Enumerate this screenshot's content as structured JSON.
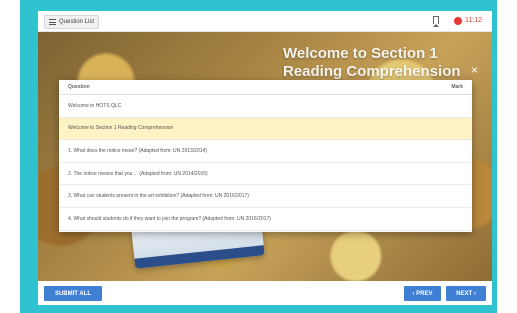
{
  "topbar": {
    "question_list_label": "Question List",
    "timer": "11:12",
    "icons": [
      "menu-icon",
      "bookmark-icon",
      "timer-dot-icon"
    ]
  },
  "stage": {
    "welcome_line1": "Welcome to Section 1",
    "welcome_line2": "Reading Comprehension",
    "close_glyph": "×"
  },
  "modal": {
    "header_question": "Question",
    "header_mark": "Mark",
    "rows": [
      "Welcome to HOTS QLC",
      "Welcome to Section 1 Reading Comprehension",
      "1. What does the notice mean? (Adapted from: UN 2013/2014)",
      "2. The notice means that you ... (Adapted from: UN 2014/2015)",
      "3. What can students present in the art exhibition? (Adapted from: UN 2016/2017)",
      "4. What should students do if they want to join the program? (Adapted from: UN 2016/2017)"
    ],
    "active_row_index": 1
  },
  "bottombar": {
    "submit_all": "SUBMIT ALL",
    "prev": "‹ PREV",
    "next": "NEXT ›"
  },
  "colors": {
    "frame": "#2fc3cf",
    "button": "#3f7fd4",
    "active_row": "#fdf3c4",
    "timer": "#e53935"
  }
}
